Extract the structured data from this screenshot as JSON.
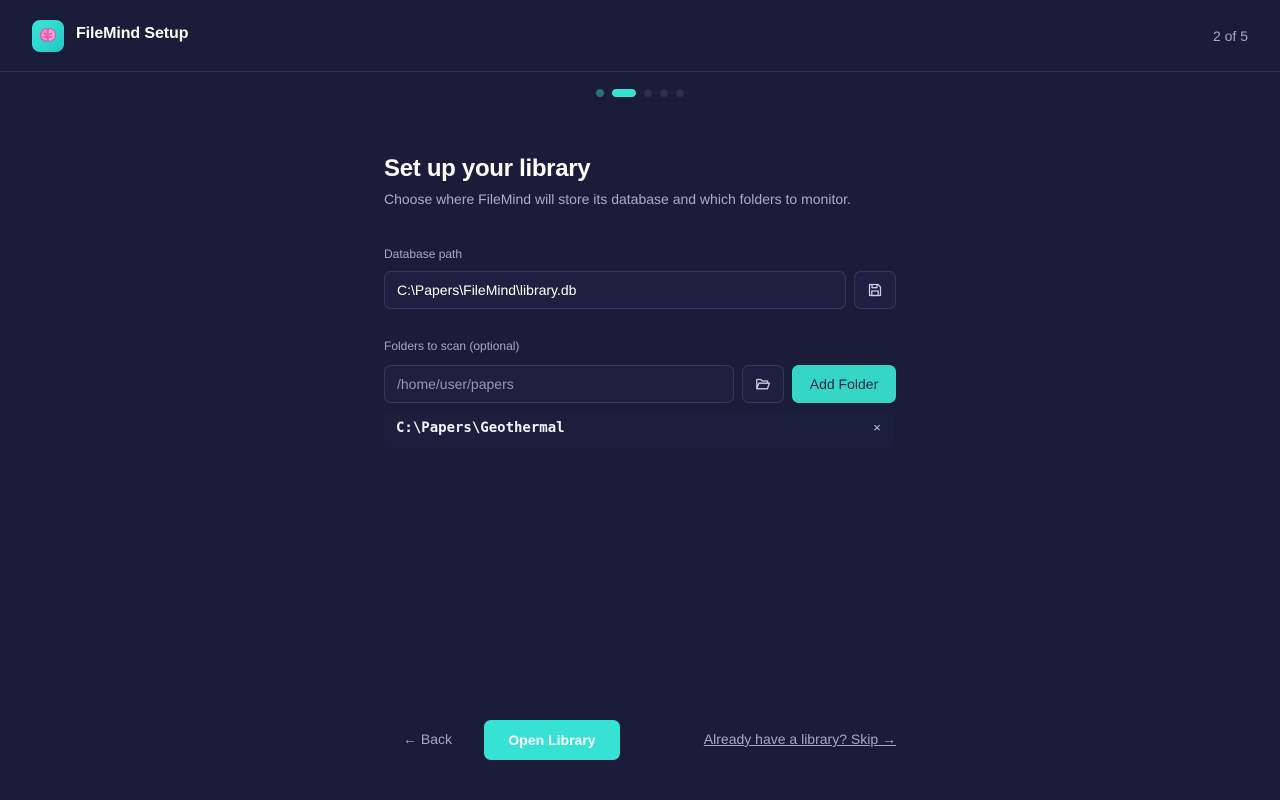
{
  "header": {
    "app_title": "FileMind Setup",
    "step_counter": "2 of 5",
    "logo_icon": "brain-icon"
  },
  "progress": {
    "current_step": 2,
    "total_steps": 5
  },
  "main": {
    "title": "Set up your library",
    "subtitle": "Choose where FileMind will store its database and which folders to monitor.",
    "database": {
      "label": "Database path",
      "value": "C:\\Papers\\FileMind\\library.db",
      "browse_icon": "save-icon"
    },
    "folders": {
      "label": "Folders to scan (optional)",
      "placeholder": "/home/user/papers",
      "value": "",
      "browse_icon": "folder-open-icon",
      "add_label": "Add Folder",
      "items": [
        {
          "path": "C:\\Papers\\Geothermal",
          "remove_label": "×"
        }
      ]
    }
  },
  "footer": {
    "back_label": "← Back",
    "open_label": "Open Library",
    "skip_label": "Already have a library? Skip →"
  },
  "colors": {
    "background": "#1a1c3a",
    "accent": "#36e2d3",
    "muted_text": "#a4a8c6"
  }
}
